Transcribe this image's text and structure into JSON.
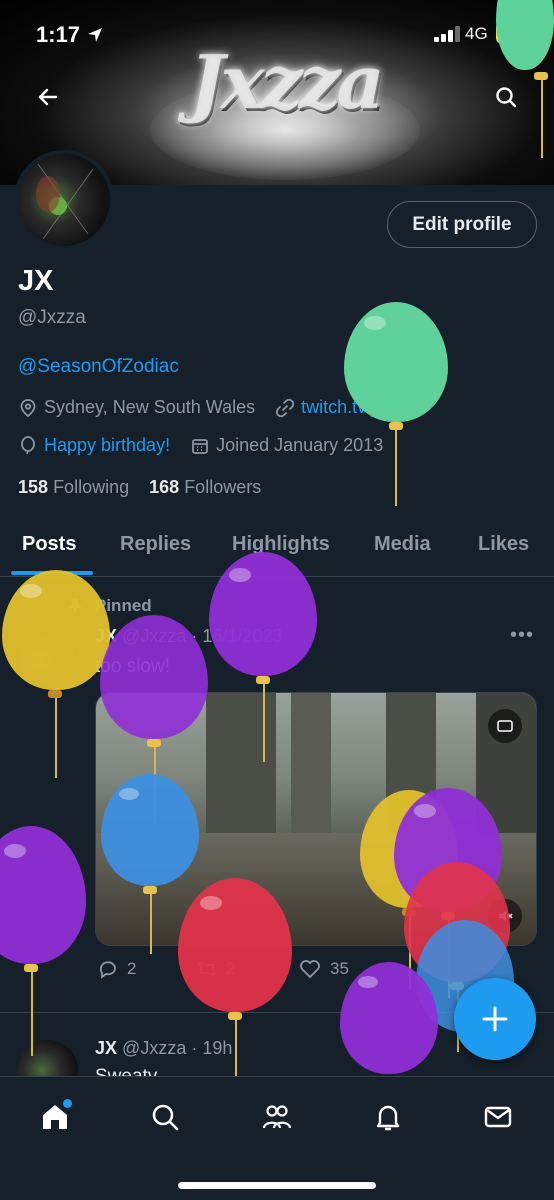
{
  "status_bar": {
    "time": "1:17",
    "network": "4G",
    "battery": "22"
  },
  "banner": {
    "logo_text": "Jxzza"
  },
  "profile": {
    "edit_label": "Edit profile",
    "name": "JX",
    "handle": "@Jxzza",
    "bio_link": "@SeasonOfZodiac",
    "location": "Sydney, New South Wales",
    "website": "twitch.tv/jxzzas",
    "birthday": "Happy birthday!",
    "joined": "Joined January 2013",
    "following_count": "158",
    "following_label": "Following",
    "followers_count": "168",
    "followers_label": "Followers"
  },
  "tabs": [
    {
      "label": "Posts"
    },
    {
      "label": "Replies"
    },
    {
      "label": "Highlights"
    },
    {
      "label": "Media"
    },
    {
      "label": "Likes"
    }
  ],
  "pinned_post": {
    "pinned_label": "Pinned",
    "name": "JX",
    "handle": "@Jxzza",
    "date": "· 16/1/2023",
    "text": "too slow!",
    "replies": "2",
    "reposts": "2",
    "likes": "35",
    "more": "•••"
  },
  "second_post": {
    "name": "JX",
    "handle": "@Jxzza",
    "date": "· 19h",
    "text": "Sweaty"
  },
  "icons": [
    "back-arrow-icon",
    "search-icon",
    "location-icon",
    "link-icon",
    "balloon-icon",
    "calendar-icon",
    "pin-icon",
    "reply-icon",
    "repost-icon",
    "like-icon",
    "plus-icon",
    "home-icon",
    "explore-icon",
    "communities-icon",
    "bell-icon",
    "mail-icon"
  ],
  "colors": {
    "accent": "#1d9bf0",
    "background": "#15202b",
    "muted": "#8b98a5",
    "battery": "#f1d441"
  }
}
